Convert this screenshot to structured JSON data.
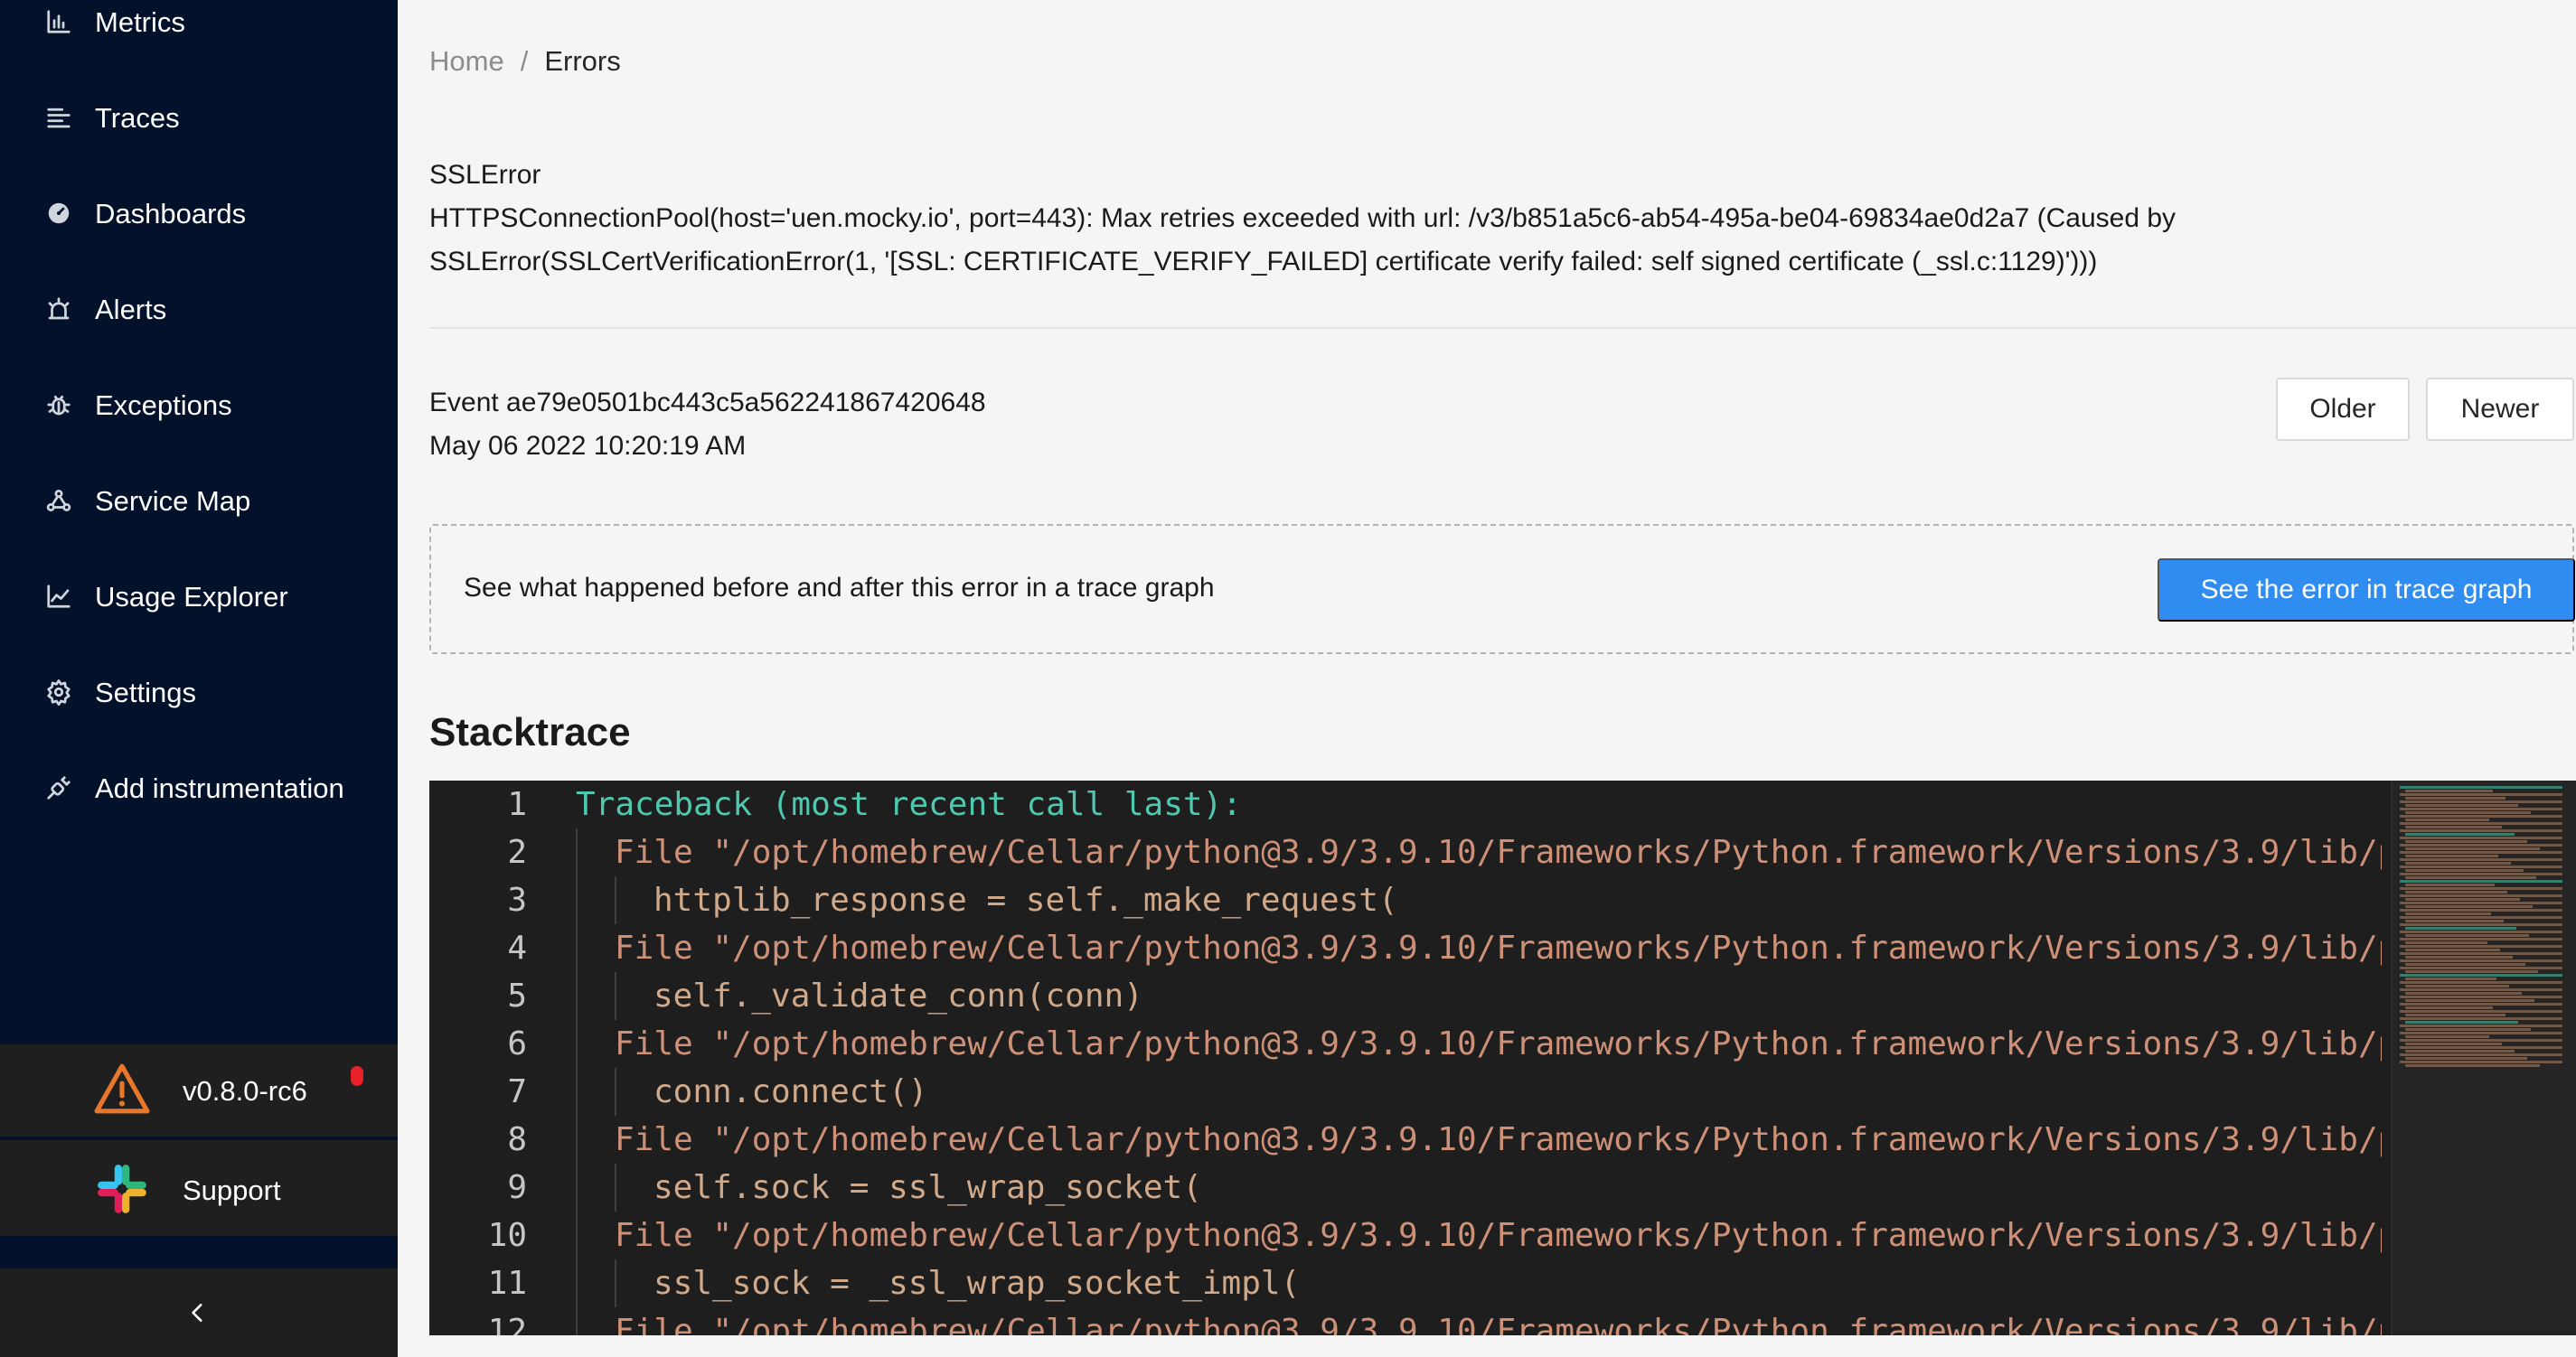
{
  "sidebar": {
    "items": [
      {
        "label": "Metrics",
        "icon": "bar-chart-icon"
      },
      {
        "label": "Traces",
        "icon": "align-left-icon"
      },
      {
        "label": "Dashboards",
        "icon": "dashboard-gauge-icon"
      },
      {
        "label": "Alerts",
        "icon": "alarm-light-icon"
      },
      {
        "label": "Exceptions",
        "icon": "bug-icon"
      },
      {
        "label": "Service Map",
        "icon": "deployment-unit-icon"
      },
      {
        "label": "Usage Explorer",
        "icon": "line-chart-icon"
      },
      {
        "label": "Settings",
        "icon": "gear-icon"
      },
      {
        "label": "Add instrumentation",
        "icon": "api-plug-icon"
      }
    ],
    "version": {
      "label": "v0.8.0-rc6",
      "icon": "warning-triangle-icon",
      "badge_color": "#e8202a"
    },
    "support": {
      "label": "Support",
      "icon": "slack-icon"
    },
    "collapse_icon": "chevron-left-icon"
  },
  "breadcrumb": {
    "home": "Home",
    "separator": "/",
    "current": "Errors"
  },
  "error": {
    "type": "SSLError",
    "message_line1": "HTTPSConnectionPool(host='uen.mocky.io', port=443): Max retries exceeded with url: /v3/b851a5c6-ab54-495a-be04-69834ae0d2a7 (Caused by",
    "message_line2": "SSLError(SSLCertVerificationError(1, '[SSL: CERTIFICATE_VERIFY_FAILED] certificate verify failed: self signed certificate (_ssl.c:1129)')))"
  },
  "event": {
    "id_text": "Event ae79e0501bc443c5a562241867420648",
    "timestamp": "May 06 2022 10:20:19 AM",
    "older_label": "Older",
    "newer_label": "Newer"
  },
  "trace_callout": {
    "text": "See what happened before and after this error in a trace graph",
    "button_label": "See the error in trace graph"
  },
  "stacktrace": {
    "title": "Stacktrace",
    "lines": [
      {
        "n": "1",
        "text": "Traceback (most recent call last):",
        "indent": 0,
        "kind": "head"
      },
      {
        "n": "2",
        "text": "File \"/opt/homebrew/Cellar/python@3.9/3.9.10/Frameworks/Python.framework/Versions/3.9/lib/p",
        "indent": 1,
        "kind": "file"
      },
      {
        "n": "3",
        "text": "httplib_response = self._make_request(",
        "indent": 2,
        "kind": "code"
      },
      {
        "n": "4",
        "text": "File \"/opt/homebrew/Cellar/python@3.9/3.9.10/Frameworks/Python.framework/Versions/3.9/lib/p",
        "indent": 1,
        "kind": "file"
      },
      {
        "n": "5",
        "text": "self._validate_conn(conn)",
        "indent": 2,
        "kind": "code"
      },
      {
        "n": "6",
        "text": "File \"/opt/homebrew/Cellar/python@3.9/3.9.10/Frameworks/Python.framework/Versions/3.9/lib/p",
        "indent": 1,
        "kind": "file"
      },
      {
        "n": "7",
        "text": "conn.connect()",
        "indent": 2,
        "kind": "code"
      },
      {
        "n": "8",
        "text": "File \"/opt/homebrew/Cellar/python@3.9/3.9.10/Frameworks/Python.framework/Versions/3.9/lib/p",
        "indent": 1,
        "kind": "file"
      },
      {
        "n": "9",
        "text": "self.sock = ssl_wrap_socket(",
        "indent": 2,
        "kind": "code"
      },
      {
        "n": "10",
        "text": "File \"/opt/homebrew/Cellar/python@3.9/3.9.10/Frameworks/Python.framework/Versions/3.9/lib/p",
        "indent": 1,
        "kind": "file"
      },
      {
        "n": "11",
        "text": "ssl_sock = _ssl_wrap_socket_impl(",
        "indent": 2,
        "kind": "code"
      },
      {
        "n": "12",
        "text": "File \"/opt/homebrew/Cellar/python@3.9/3.9.10/Frameworks/Python.framework/Versions/3.9/lib/p",
        "indent": 1,
        "kind": "file"
      }
    ]
  },
  "colors": {
    "sidebar_bg": "#03112b",
    "primary": "#2f8cf0",
    "editor_bg": "#1e1e1e",
    "traceback_teal": "#4ec9b0",
    "string_orange": "#ce9178"
  }
}
